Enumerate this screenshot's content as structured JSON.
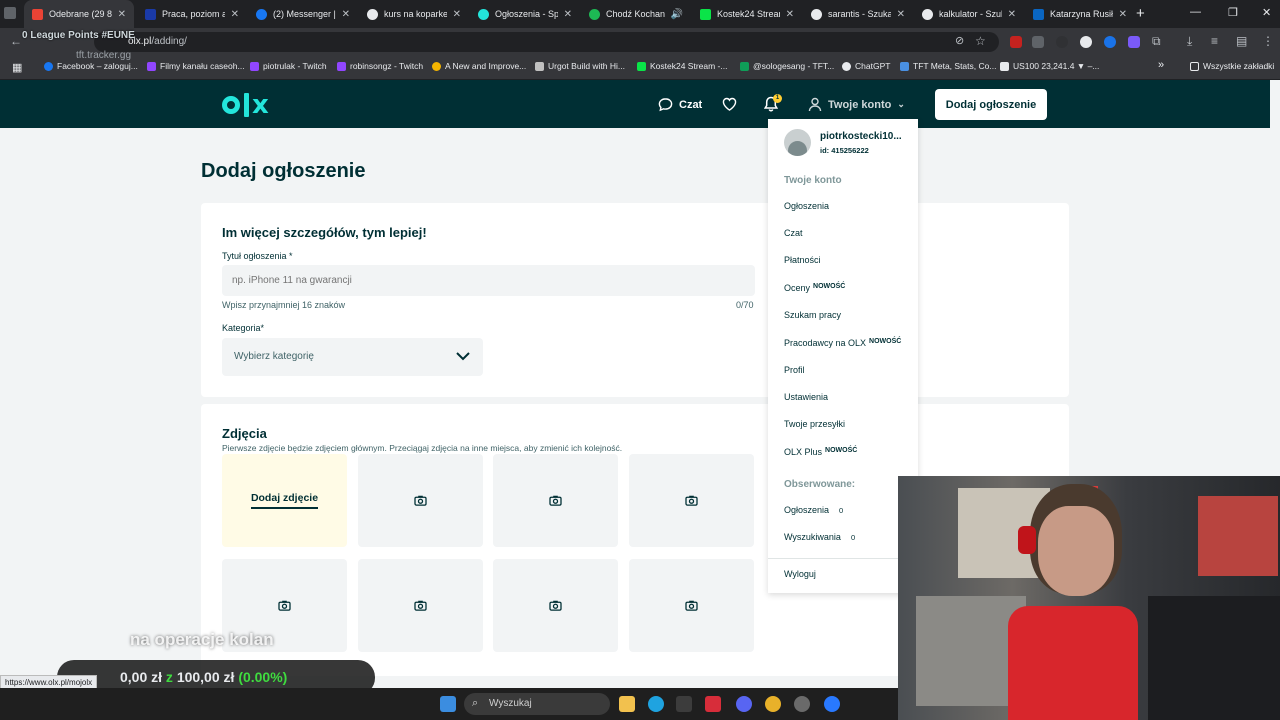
{
  "browser": {
    "tabs": [
      {
        "title": "Odebrane (29 884)",
        "color": "#ea4335",
        "active": true
      },
      {
        "title": "Praca, poziom asy",
        "color": "#1a3aa8"
      },
      {
        "title": "(2) Messenger | Fa",
        "color": "#1877f2"
      },
      {
        "title": "kurs na koparke -",
        "color": "#e8eaed"
      },
      {
        "title": "Ogłoszenia - Sprz",
        "color": "#23e5db"
      },
      {
        "title": "Chodź Kochan",
        "color": "#1db954"
      },
      {
        "title": "Kostek24 Stream",
        "color": "#0ae448"
      },
      {
        "title": "sarantis - Szukaj",
        "color": "#e8eaed"
      },
      {
        "title": "kalkulator - Szuka",
        "color": "#e8eaed"
      },
      {
        "title": "Katarzyna Rusiłow",
        "color": "#0a66c2"
      }
    ],
    "url_prefix": "",
    "url_host": "olx.pl",
    "url_path": "/adding/",
    "bookmarks": [
      {
        "label": "Facebook – zaloguj...",
        "color": "#1877f2"
      },
      {
        "label": "Filmy kanału caseoh...",
        "color": "#9146ff"
      },
      {
        "label": "piotrulak - Twitch",
        "color": "#9146ff"
      },
      {
        "label": "robinsongz - Twitch",
        "color": "#9146ff"
      },
      {
        "label": "A New and Improve...",
        "color": "#f4b400"
      },
      {
        "label": "Urgot Build with Hi...",
        "color": "#c0c0c0"
      },
      {
        "label": "Kostek24 Stream -...",
        "color": "#0ae448"
      },
      {
        "label": "@sologesang - TFT...",
        "color": "#0f9d58"
      },
      {
        "label": "ChatGPT",
        "color": "#e8eaed"
      },
      {
        "label": "TFT Meta, Stats, Co...",
        "color": "#4a90e2"
      },
      {
        "label": "US100 23,241.4 ▼ –...",
        "color": "#e8eaed"
      }
    ],
    "other_bookmarks": "Wszystkie zakładki"
  },
  "overlay": {
    "league_points": "0 League Points #EUNE",
    "tracker": "tft.tracker.gg",
    "subtitle": "na operacje kolan",
    "stat_left": "0,00 zł",
    "stat_z": "z",
    "stat_right": "100,00 zł",
    "stat_pct": "(0.00%)",
    "status_url": "https://www.olx.pl/mojolx"
  },
  "olx": {
    "chat": "Czat",
    "notifications_count": "1",
    "account": "Twoje konto",
    "add_ad": "Dodaj ogłoszenie"
  },
  "form": {
    "page_title": "Dodaj ogłoszenie",
    "details_heading": "Im więcej szczegółów, tym lepiej!",
    "title_label": "Tytuł ogłoszenia *",
    "title_placeholder": "np. iPhone 11 na gwarancji",
    "title_hint": "Wpisz przynajmniej 16 znaków",
    "title_count": "0/70",
    "category_label": "Kategoria*",
    "category_placeholder": "Wybierz kategorię",
    "photos_heading": "Zdjęcia",
    "photos_desc": "Pierwsze zdjęcie będzie zdjęciem głównym. Przeciągaj zdjęcia na inne miejsca, aby zmienić ich kolejność.",
    "add_photo": "Dodaj zdjęcie"
  },
  "menu": {
    "user_name": "piotrkostecki10...",
    "user_id": "id: 415256222",
    "section_account": "Twoje konto",
    "items": [
      {
        "label": "Ogłoszenia",
        "badge": ""
      },
      {
        "label": "Czat",
        "badge": ""
      },
      {
        "label": "Płatności",
        "badge": ""
      },
      {
        "label": "Oceny",
        "badge": "NOWOŚĆ"
      },
      {
        "label": "Szukam pracy",
        "badge": ""
      },
      {
        "label": "Pracodawcy na OLX",
        "badge": "NOWOŚĆ"
      },
      {
        "label": "Profil",
        "badge": ""
      },
      {
        "label": "Ustawienia",
        "badge": ""
      },
      {
        "label": "Twoje przesyłki",
        "badge": ""
      },
      {
        "label": "OLX Plus",
        "badge": "NOWOŚĆ"
      }
    ],
    "section_watched": "Obserwowane:",
    "watched": [
      {
        "label": "Ogłoszenia",
        "count": "0"
      },
      {
        "label": "Wyszukiwania",
        "count": "0"
      }
    ],
    "logout": "Wyloguj"
  },
  "taskbar": {
    "search": "Wyszukaj"
  },
  "icons": {
    "chat": "chat-bubble-icon",
    "favorites": "heart-icon",
    "notifications": "bell-icon",
    "account": "user-icon",
    "photo": "camera-icon",
    "dropdown": "chevron-down-icon"
  },
  "colors": {
    "olx_dark": "#002f34",
    "olx_accent": "#23e5db",
    "badge": "#ffce32"
  }
}
